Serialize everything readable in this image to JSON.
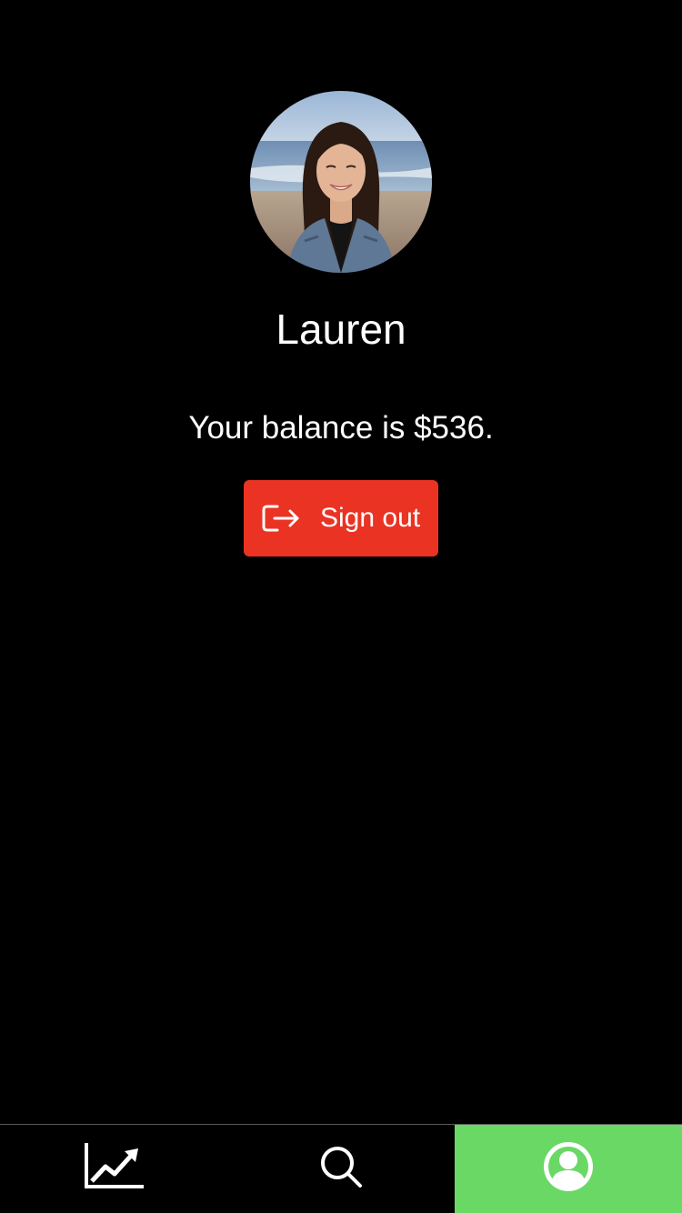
{
  "profile": {
    "name": "Lauren",
    "balance_text": "Your balance is $536."
  },
  "actions": {
    "sign_out_label": "Sign out",
    "sign_out_icon": "sign-out-icon",
    "sign_out_color": "#ea3323"
  },
  "tabs": [
    {
      "icon": "trending-chart-icon",
      "active": false
    },
    {
      "icon": "search-icon",
      "active": false
    },
    {
      "icon": "user-account-icon",
      "active": true
    }
  ],
  "colors": {
    "background": "#000000",
    "active_tab": "#6ad865",
    "text": "#ffffff"
  }
}
